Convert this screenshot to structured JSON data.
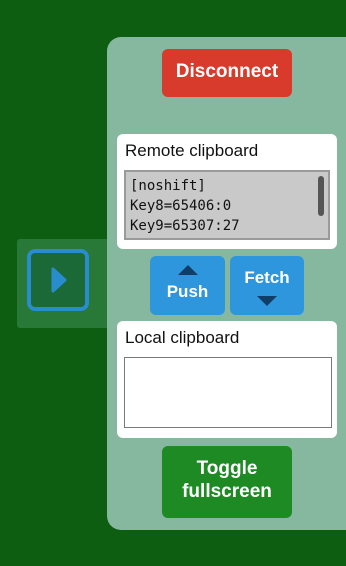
{
  "handle": {
    "icon": "play-icon"
  },
  "panel": {
    "disconnect_label": "Disconnect",
    "remote": {
      "title": "Remote clipboard",
      "lines": [
        "[noshift]",
        "Key8=65406:0",
        "Key9=65307:27"
      ]
    },
    "push": {
      "label": "Push",
      "icon": "up-arrow-icon"
    },
    "fetch": {
      "label": "Fetch",
      "icon": "down-arrow-icon"
    },
    "local": {
      "title": "Local clipboard",
      "value": ""
    },
    "toggle_label_1": "Toggle",
    "toggle_label_2": "fullscreen"
  },
  "colors": {
    "background": "#0e5e12",
    "panel": "#86b8a0",
    "disconnect": "#d83a2b",
    "action_blue": "#2d96dc",
    "toggle_green": "#1e8a24"
  }
}
